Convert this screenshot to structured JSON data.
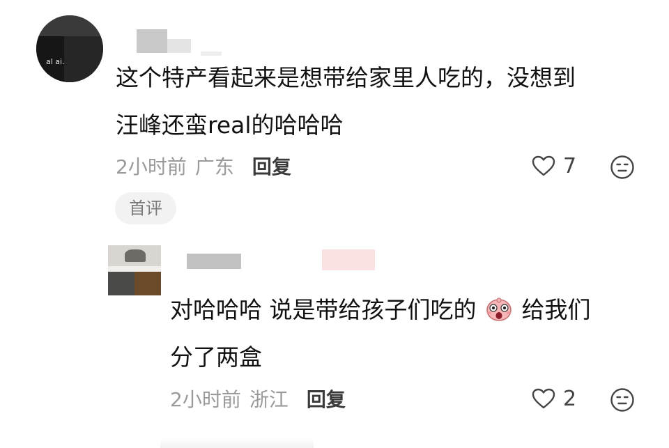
{
  "comments": [
    {
      "avatar_text": "al ai.",
      "text_line1": "这个特产看起来是想带给家里人吃的，没想到",
      "text_line2": "汪峰还蛮real的哈哈哈",
      "time": "2小时前",
      "location": "广东",
      "reply_label": "回复",
      "likes": "7",
      "badge": "首评"
    },
    {
      "text_line1_a": "对哈哈哈 说是带给孩子们吃的",
      "text_line1_b": "给我们",
      "text_line2": "分了两盒",
      "emoji": "surprised-face-emoji",
      "time": "2小时前",
      "location": "浙江",
      "reply_label": "回复",
      "likes": "2"
    }
  ],
  "icons": {
    "like": "heart-outline-icon",
    "react": "neutral-face-icon"
  },
  "colors": {
    "text": "#111111",
    "meta": "#9a9a9a",
    "reply": "#3a3a3a",
    "badge_bg": "#f2f2f2"
  }
}
